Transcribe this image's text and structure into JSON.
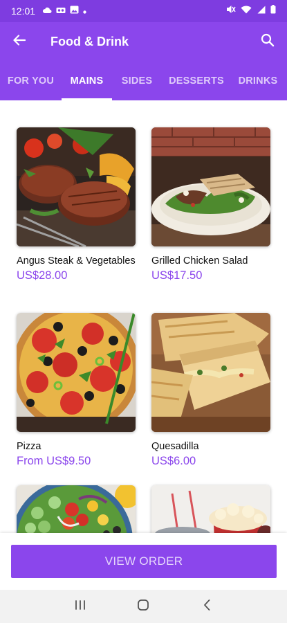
{
  "status_bar": {
    "time": "12:01",
    "left_icons": [
      "cloud-icon",
      "voicemail-icon",
      "image-icon",
      "dot-icon"
    ],
    "right_icons": [
      "mute-icon",
      "wifi-icon",
      "signal-icon",
      "battery-icon"
    ]
  },
  "app_bar": {
    "title": "Food & Drink",
    "back_icon": "back-arrow-icon",
    "search_icon": "search-icon"
  },
  "tabs": [
    {
      "label": "FOR YOU",
      "active": false
    },
    {
      "label": "MAINS",
      "active": true
    },
    {
      "label": "SIDES",
      "active": false
    },
    {
      "label": "DESSERTS",
      "active": false
    },
    {
      "label": "DRINKS",
      "active": false
    }
  ],
  "items": [
    {
      "name": "Angus Steak & Vegetables",
      "price": "US$28.00"
    },
    {
      "name": "Grilled Chicken Salad",
      "price": "US$17.50"
    },
    {
      "name": "Pizza",
      "price": "From US$9.50"
    },
    {
      "name": "Quesadilla",
      "price": "US$6.00"
    },
    {
      "name": "",
      "price": ""
    },
    {
      "name": "",
      "price": ""
    }
  ],
  "bottom": {
    "view_order_label": "VIEW ORDER"
  },
  "nav_bar": {
    "icons": [
      "recents-icon",
      "home-icon",
      "back-icon"
    ]
  },
  "colors": {
    "accent": "#8b46ec",
    "status_bar": "#7e3ce0",
    "price": "#8b46ec"
  }
}
